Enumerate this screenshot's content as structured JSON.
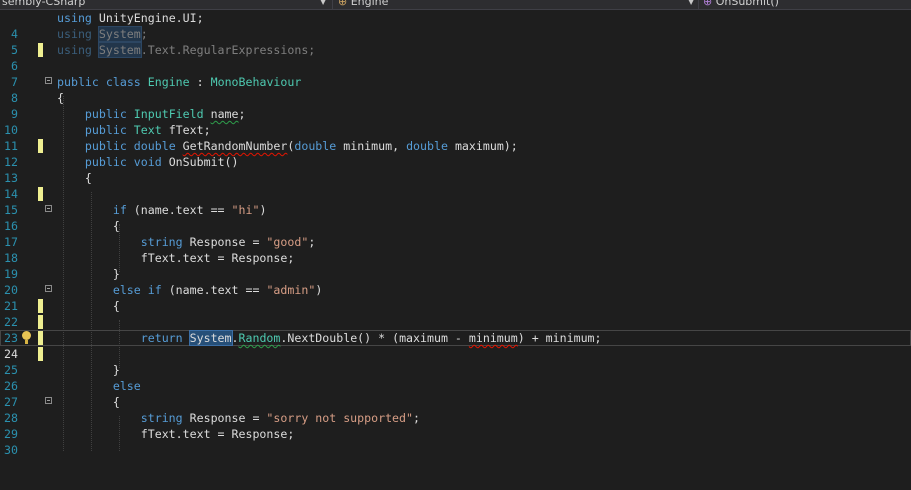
{
  "nav": {
    "project": "sembly-CSharp",
    "class": "Engine",
    "member": "OnSubmit()"
  },
  "lines": {
    "n4": "4",
    "n5": "5",
    "n6": "6",
    "n7": "7",
    "n8": "8",
    "n9": "9",
    "n10": "10",
    "n11": "11",
    "n12": "12",
    "n13": "13",
    "n14": "14",
    "n15": "15",
    "n16": "16",
    "n17": "17",
    "n18": "18",
    "n19": "19",
    "n20": "20",
    "n21": "21",
    "n22": "22",
    "n23": "23",
    "n24": "24",
    "n25": "25",
    "n26": "26",
    "n27": "27",
    "n28": "28",
    "n29": "29",
    "n30": "30"
  },
  "code": {
    "using": "using",
    "unityui": "UnityEngine.UI;",
    "system": "System",
    "semicolon": ";",
    "regex_rest": ".Text.RegularExpressions;",
    "public": "public",
    "class": "class",
    "engine": "Engine",
    "colon": " : ",
    "monobehaviour": "MonoBehaviour",
    "open_brace": "{",
    "close_brace": "}",
    "inputfield": "InputField",
    "name_field": "name",
    "text_type": "Text",
    "ftext_decl": "fText;",
    "double": "double",
    "getrandom": "GetRandomNumber",
    "paren_open": "(",
    "minimum_param": "minimum, ",
    "maximum_param": "maximum);",
    "void": "void",
    "onsubmit": "OnSubmit()",
    "if": "if",
    "else": "else",
    "cond_hi_pre": "(name.text == ",
    "str_hi": "\"hi\"",
    "close_paren": ")",
    "string": "string",
    "response_assign": "Response = ",
    "str_good": "\"good\"",
    "ftext_assign": "fText.text = Response;",
    "str_admin": "\"admin\"",
    "return": "return",
    "dot": ".",
    "random": "Random",
    "nextdouble": ".NextDouble() * (maximum - ",
    "minimum": "minimum",
    "tail": ") + minimum;",
    "str_sorry": "\"sorry not supported\""
  }
}
